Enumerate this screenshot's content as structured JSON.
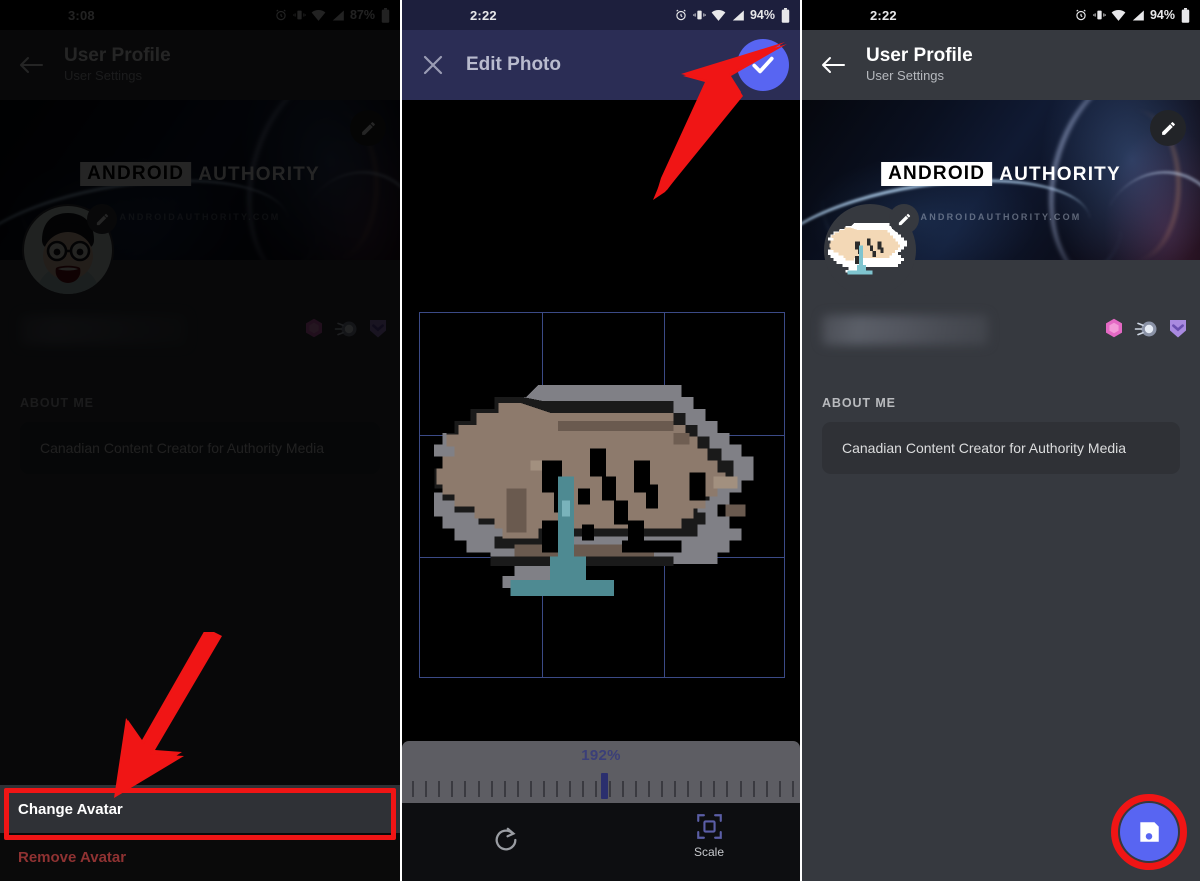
{
  "panels": [
    {
      "id": "profile-dimmed",
      "statusbar": {
        "time": "3:08",
        "battery": "87%",
        "icons": [
          "alarm-icon",
          "vibrate-icon",
          "wifi-icon",
          "signal-icon",
          "battery-icon"
        ]
      },
      "appbar": {
        "back_icon": "back-arrow-icon",
        "title": "User Profile",
        "subtitle": "User Settings"
      },
      "banner": {
        "logo_box": "ANDROID",
        "logo_word": "AUTHORITY",
        "watermark": "ANDROIDAUTHORITY.COM",
        "edit_icon": "pencil-icon"
      },
      "avatar": {
        "edit_icon": "pencil-icon",
        "kind": "cartoon-face-avatar"
      },
      "username": "",
      "badges": [
        "hexagon-badge",
        "orb-badge",
        "shield-badge"
      ],
      "about": {
        "label": "ABOUT ME",
        "text": "Canadian Content Creator for Authority Media"
      },
      "sheet": {
        "change_avatar": "Change Avatar",
        "remove_avatar": "Remove Avatar"
      },
      "annotation": {
        "arrow": "red-arrow-down-left",
        "highlight": "red-highlight-box"
      }
    },
    {
      "id": "photo-editor",
      "statusbar": {
        "time": "2:22",
        "battery": "94%",
        "icons": [
          "alarm-icon",
          "vibrate-icon",
          "wifi-icon",
          "signal-icon",
          "battery-icon"
        ]
      },
      "appbar": {
        "close_icon": "close-x-icon",
        "title": "Edit Photo",
        "confirm_icon": "checkmark-icon",
        "confirm_color": "#5865f2"
      },
      "crop": {
        "grid": "rule-of-thirds",
        "image": "pixel-art-avatar"
      },
      "scale": {
        "value": "192%",
        "ticks": 30,
        "thumb_position_pct": 50
      },
      "tools": [
        {
          "name": "rotate",
          "icon": "rotate-cw-icon",
          "label": "",
          "active": false
        },
        {
          "name": "scale",
          "icon": "scale-crop-icon",
          "label": "Scale",
          "active": true
        }
      ],
      "annotation": {
        "arrow": "red-arrow-up-right"
      }
    },
    {
      "id": "profile-saved",
      "statusbar": {
        "time": "2:22",
        "battery": "94%",
        "icons": [
          "alarm-icon",
          "vibrate-icon",
          "wifi-icon",
          "signal-icon",
          "battery-icon"
        ]
      },
      "appbar": {
        "back_icon": "back-arrow-icon",
        "title": "User Profile",
        "subtitle": "User Settings"
      },
      "banner": {
        "logo_box": "ANDROID",
        "logo_word": "AUTHORITY",
        "watermark": "ANDROIDAUTHORITY.COM",
        "edit_icon": "pencil-icon"
      },
      "avatar": {
        "edit_icon": "pencil-icon",
        "kind": "pixel-art-avatar"
      },
      "username": "",
      "badges": [
        "hexagon-badge",
        "orb-badge",
        "shield-badge"
      ],
      "about": {
        "label": "ABOUT ME",
        "text": "Canadian Content Creator for Authority Media"
      },
      "save": {
        "icon": "save-floppy-icon",
        "color": "#5865f2"
      },
      "annotation": {
        "arrow": "red-arrow-down-right",
        "highlight": "red-ring"
      }
    }
  ],
  "colors": {
    "accent_blurple": "#5865f2",
    "annotation_red": "#f01515",
    "profile_bg": "#36393f",
    "card_bg": "#2f3136",
    "editor_appbar": "#2b2d55",
    "remove_red": "#8f3232",
    "scale_track": "#5d5d63",
    "scale_value_text": "#3b3f78"
  }
}
